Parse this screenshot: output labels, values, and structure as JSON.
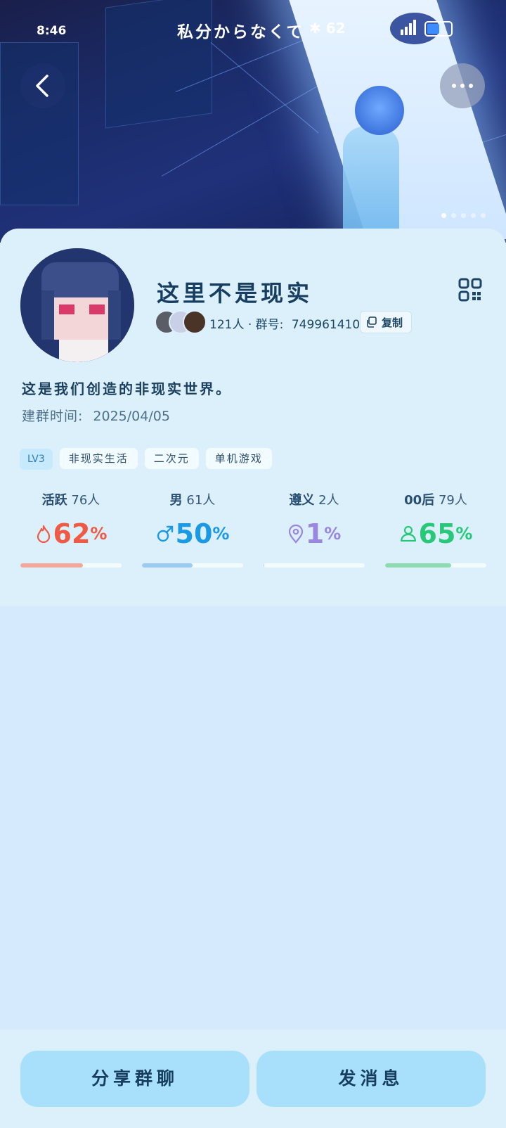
{
  "status_bar": {
    "time": "8:46",
    "ticker": "私分からなくて",
    "network": "62",
    "battery_level": 0.55,
    "accent": "#3a8cff"
  },
  "header": {
    "back_icon": "chevron-left-icon",
    "more_icon": "more-dots-icon",
    "pager_count": 5,
    "pager_active": 0
  },
  "group": {
    "name": "这里不是现实",
    "members_count_text": "121人",
    "id_label": "群号:",
    "id_value": "749961410",
    "copy_label": "复制",
    "description": "这是我们创造的非现实世界。",
    "created_label": "建群时间:",
    "created_value": "2025/04/05"
  },
  "tags": [
    "LV3",
    "非现实生活",
    "二次元",
    "单机游戏"
  ],
  "stats": [
    {
      "label": "活跃",
      "count": "76人",
      "value": "62",
      "unit": "%",
      "icon": "flame-icon",
      "color": "#f05a44",
      "bar_color": "#f5a79a",
      "fill": 0.62
    },
    {
      "label": "男",
      "count": "61人",
      "value": "50",
      "unit": "%",
      "icon": "male-icon",
      "color": "#1a9ae6",
      "bar_color": "#9dcaf3",
      "fill": 0.5
    },
    {
      "label": "遵义",
      "count": "2人",
      "value": "1",
      "unit": "%",
      "icon": "location-pin-icon",
      "color": "#9a86e0",
      "bar_color": "#c9bff1",
      "fill": 0.01
    },
    {
      "label": "00后",
      "count": "79人",
      "value": "65",
      "unit": "%",
      "icon": "person-icon",
      "color": "#27c978",
      "bar_color": "#8fdbb0",
      "fill": 0.65
    }
  ],
  "actions": {
    "share_label": "分享群聊",
    "message_label": "发消息"
  }
}
